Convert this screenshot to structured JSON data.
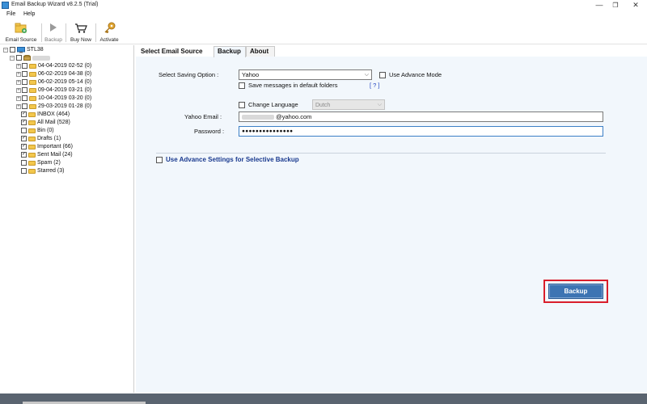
{
  "window": {
    "title": "Email Backup Wizard v8.2.5 (Trial)",
    "minimize": "—",
    "maximize": "❐",
    "close": "✕"
  },
  "menu": [
    "File",
    "Help"
  ],
  "toolbar": {
    "email_source": "Email Source",
    "backup": "Backup",
    "buy_now": "Buy Now",
    "activate": "Activate"
  },
  "tree": {
    "root": "STL38",
    "account": "",
    "items": [
      {
        "label": "04-04-2019 02-52 (0)",
        "checked": false
      },
      {
        "label": "06-02-2019 04-38 (0)",
        "checked": false
      },
      {
        "label": "06-02-2019 05-14 (0)",
        "checked": false
      },
      {
        "label": "09-04-2019 03-21 (0)",
        "checked": false
      },
      {
        "label": "10-04-2019 03-20 (0)",
        "checked": false
      },
      {
        "label": "29-03-2019 01-28 (0)",
        "checked": false
      },
      {
        "label": "INBOX (464)",
        "checked": true
      },
      {
        "label": "All Mail (528)",
        "checked": true
      },
      {
        "label": "Bin (0)",
        "checked": false
      },
      {
        "label": "Drafts (1)",
        "checked": true
      },
      {
        "label": "Important (66)",
        "checked": true
      },
      {
        "label": "Sent Mail (24)",
        "checked": true
      },
      {
        "label": "Spam (2)",
        "checked": false
      },
      {
        "label": "Starred (3)",
        "checked": false
      }
    ]
  },
  "tabs": [
    "Select Email Source",
    "Backup",
    "About"
  ],
  "form": {
    "saving_option_label": "Select Saving Option :",
    "saving_option_value": "Yahoo",
    "use_advance_mode": "Use Advance Mode",
    "save_default": "Save messages in default folders",
    "help_link": "[ ? ]",
    "change_language": "Change Language",
    "language_value": "Dutch",
    "yahoo_email_label": "Yahoo Email :",
    "yahoo_email_value": "@yahoo.com",
    "password_label": "Password :",
    "password_value": "●●●●●●●●●●●●●●●",
    "advance_settings": "Use Advance Settings for Selective Backup"
  },
  "backup_button": "Backup",
  "colors": {
    "accent": "#3d74b3",
    "highlight_border": "#d91e2b",
    "content_bg": "#f2f7fc"
  }
}
